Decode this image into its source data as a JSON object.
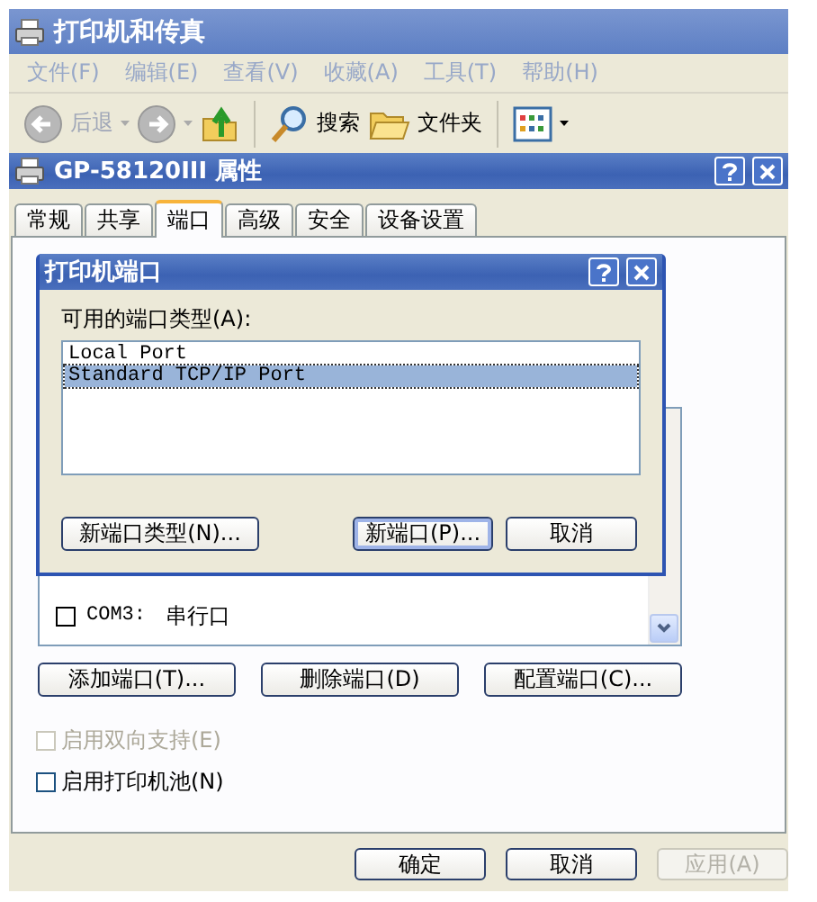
{
  "explorer": {
    "title": "打印机和传真",
    "menu": [
      "文件(F)",
      "编辑(E)",
      "查看(V)",
      "收藏(A)",
      "工具(T)",
      "帮助(H)"
    ],
    "toolbar": [
      {
        "kind": "back",
        "label": "后退",
        "disabled": true
      },
      {
        "kind": "forward",
        "disabled": true
      },
      {
        "kind": "up",
        "disabled": false
      },
      {
        "kind": "search",
        "label": "搜索",
        "disabled": false
      },
      {
        "kind": "folders",
        "label": "文件夹",
        "disabled": false
      },
      {
        "kind": "views"
      }
    ]
  },
  "properties": {
    "title": "GP-58120III 属性",
    "tabs": [
      {
        "label": "常规",
        "selected": false
      },
      {
        "label": "共享",
        "selected": false
      },
      {
        "label": "端口",
        "selected": true
      },
      {
        "label": "高级",
        "selected": false
      },
      {
        "label": "安全",
        "selected": false
      },
      {
        "label": "设备设置",
        "selected": false
      }
    ],
    "ports": [
      {
        "checked": false,
        "port": "COM3:",
        "description": "串行口"
      }
    ],
    "buttons": [
      "添加端口(T)...",
      "删除端口(D)",
      "配置端口(C)..."
    ],
    "options": [
      {
        "label": "启用双向支持(E)",
        "checked": false,
        "disabled": true
      },
      {
        "label": "启用打印机池(N)",
        "checked": false,
        "disabled": false
      }
    ],
    "footer": [
      {
        "label": "确定",
        "disabled": false
      },
      {
        "label": "取消",
        "disabled": false
      },
      {
        "label": "应用(A)",
        "disabled": true
      }
    ]
  },
  "dialog": {
    "title": "打印机端口",
    "list_label": "可用的端口类型(A):",
    "port_types": [
      {
        "label": "Local Port",
        "selected": false
      },
      {
        "label": "Standard TCP/IP Port",
        "selected": true
      }
    ],
    "buttons": [
      {
        "label": "新端口类型(N)...",
        "focused": false
      },
      {
        "label": "新端口(P)...",
        "focused": true
      },
      {
        "label": "取消",
        "focused": false
      }
    ]
  }
}
